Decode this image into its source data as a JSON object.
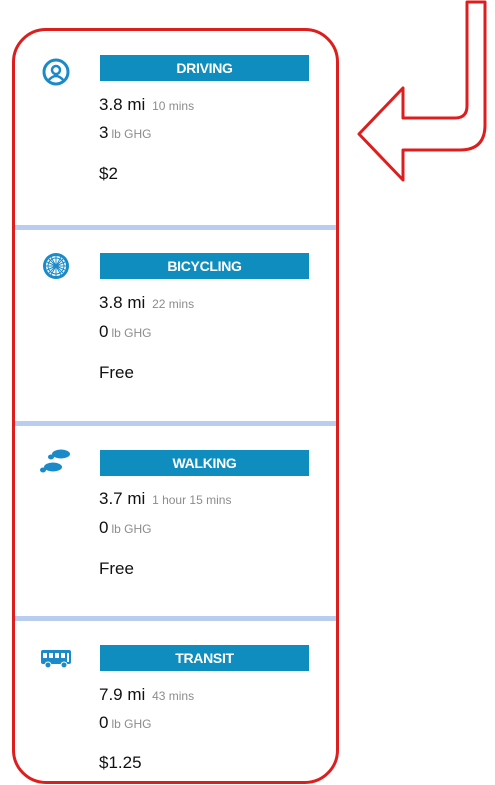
{
  "colors": {
    "outline": "#dd1e1e",
    "banner": "#0f8dbf",
    "divider": "#b9cdf0",
    "icon": "#1a8ac8"
  },
  "modes": [
    {
      "label": "DRIVING",
      "icon": "steering-wheel-icon",
      "distance_value": "3.8",
      "distance_unit": "mi",
      "duration": "10 mins",
      "ghg_value": "3",
      "ghg_unit": "lb GHG",
      "cost": "$2"
    },
    {
      "label": "BICYCLING",
      "icon": "bicycle-wheel-icon",
      "distance_value": "3.8",
      "distance_unit": "mi",
      "duration": "22 mins",
      "ghg_value": "0",
      "ghg_unit": "lb GHG",
      "cost": "Free"
    },
    {
      "label": "WALKING",
      "icon": "footprints-icon",
      "distance_value": "3.7",
      "distance_unit": "mi",
      "duration": "1 hour 15 mins",
      "ghg_value": "0",
      "ghg_unit": "lb GHG",
      "cost": "Free"
    },
    {
      "label": "TRANSIT",
      "icon": "bus-icon",
      "distance_value": "7.9",
      "distance_unit": "mi",
      "duration": "43 mins",
      "ghg_value": "0",
      "ghg_unit": "lb GHG",
      "cost": "$1.25"
    }
  ]
}
